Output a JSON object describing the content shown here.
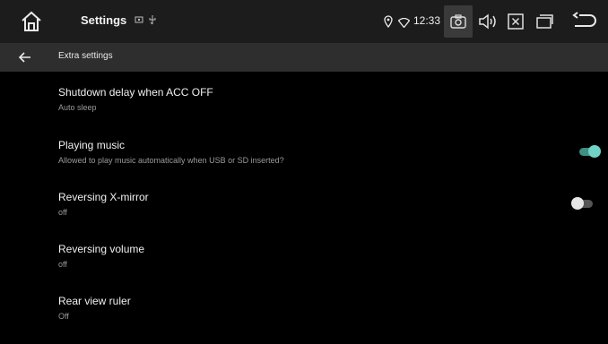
{
  "statusbar": {
    "app_title": "Settings",
    "notification_icons": "⦾ ⚲",
    "time": "12:33"
  },
  "titlebar": {
    "title": "Extra settings"
  },
  "settings": [
    {
      "title": "Shutdown delay when ACC OFF",
      "subtitle": "Auto sleep",
      "has_toggle": false
    },
    {
      "title": "Playing music",
      "subtitle": "Allowed to play music automatically when USB or SD inserted?",
      "has_toggle": true,
      "toggle_on": true
    },
    {
      "title": "Reversing X-mirror",
      "subtitle": "off",
      "has_toggle": true,
      "toggle_on": false
    },
    {
      "title": "Reversing volume",
      "subtitle": "off",
      "has_toggle": false
    },
    {
      "title": "Rear view ruler",
      "subtitle": "Off",
      "has_toggle": false
    }
  ],
  "colors": {
    "statusbar_bg": "#1c1c1c",
    "titlebar_bg": "#2e2e2e",
    "toggle_on": "#70d3c7",
    "toggle_off": "#e6e6e6"
  }
}
